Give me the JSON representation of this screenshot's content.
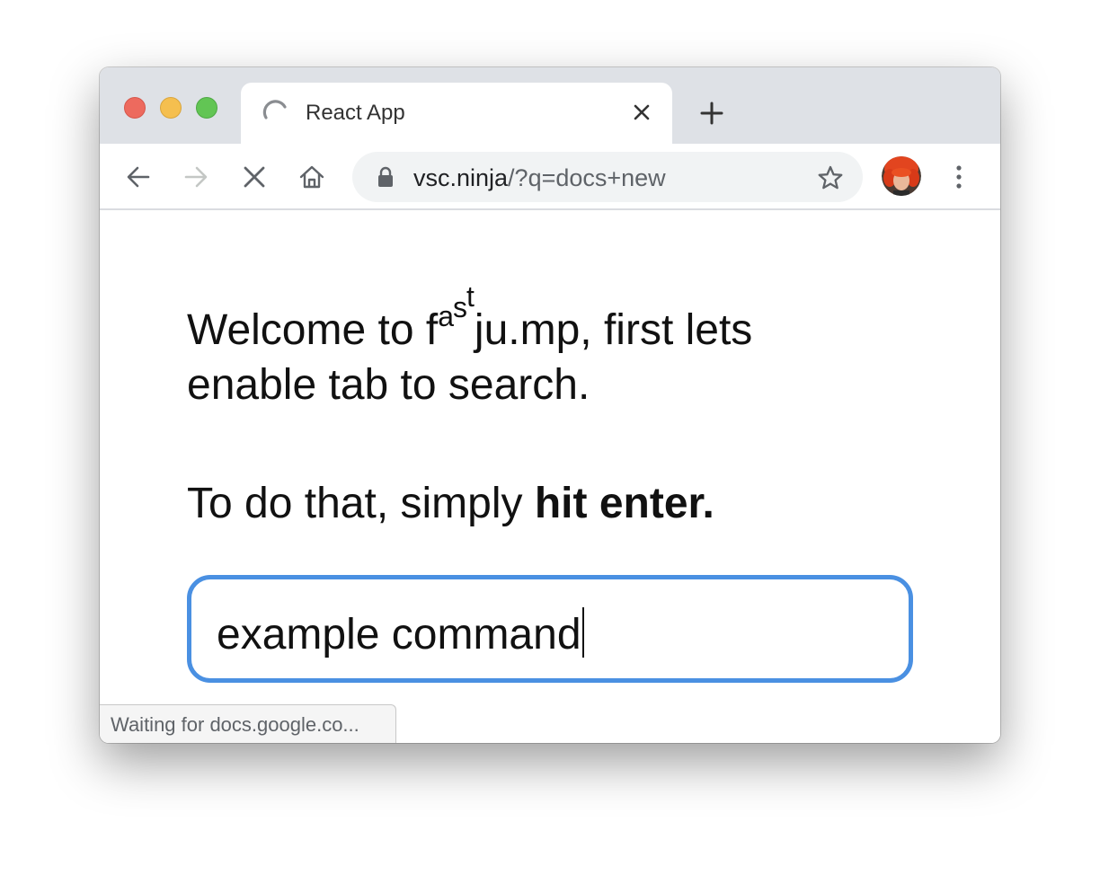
{
  "window": {
    "controls": [
      "close",
      "minimize",
      "zoom"
    ]
  },
  "tab": {
    "title": "React App",
    "status_icon": "loading-spinner-icon",
    "close_icon": "close-icon"
  },
  "new_tab_icon": "plus-icon",
  "toolbar": {
    "back_icon": "arrow-left-icon",
    "forward_icon": "arrow-right-icon",
    "stop_icon": "stop-x-icon",
    "home_icon": "home-icon",
    "menu_icon": "vertical-dots-icon"
  },
  "omnibox": {
    "lock_icon": "lock-icon",
    "host": "vsc.ninja",
    "path": "/?q=docs+new",
    "bookmark_icon": "star-icon"
  },
  "page": {
    "welcome_prefix": "Welcome to ",
    "brand_f": "f",
    "brand_a": "a",
    "brand_s": "s",
    "brand_t": "t",
    "welcome_suffix": "ju.mp, first lets enable tab to search.",
    "instruction_prefix": "To do that, simply ",
    "instruction_bold": "hit enter.",
    "command_value": "example command"
  },
  "status": {
    "text": "Waiting for docs.google.co..."
  },
  "colors": {
    "tabstrip": "#dee1e6",
    "input_focus_border": "#4a90e2",
    "traffic_red": "#ed6a5e",
    "traffic_yellow": "#f5bf4f",
    "traffic_green": "#62c554"
  }
}
